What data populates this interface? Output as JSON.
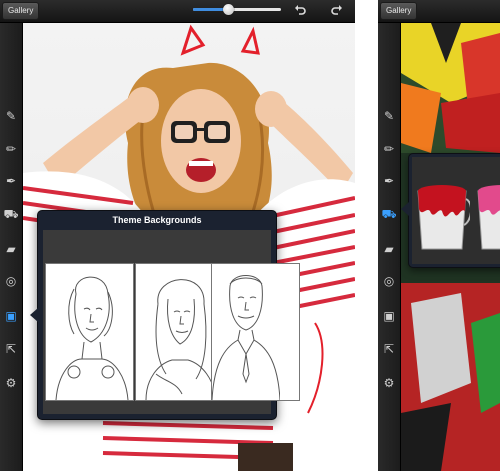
{
  "left_screen": {
    "topbar": {
      "gallery_label": "Gallery",
      "brush_size_level": 0.4,
      "undo_icon": "undo-icon",
      "redo_icon": "redo-icon"
    },
    "tools": [
      {
        "name": "marker-icon",
        "glyph": "✎"
      },
      {
        "name": "pencil-icon",
        "glyph": "✏"
      },
      {
        "name": "pen-icon",
        "glyph": "✒"
      },
      {
        "name": "paint-bucket-icon",
        "glyph": "⛟"
      },
      {
        "name": "eraser-icon",
        "glyph": "▰"
      },
      {
        "name": "spiral-icon",
        "glyph": "◎"
      },
      {
        "name": "image-icon",
        "glyph": "▣",
        "active": true
      },
      {
        "name": "share-icon",
        "glyph": "⇱"
      },
      {
        "name": "settings-icon",
        "glyph": "⚙"
      }
    ],
    "theme_popover": {
      "title": "Theme Backgrounds",
      "thumbnails": [
        "woman-sketch-thumbnail",
        "woman-portrait-sketch-thumbnail",
        "man-suit-sketch-thumbnail"
      ]
    }
  },
  "right_screen": {
    "topbar": {
      "gallery_label": "Gallery"
    },
    "tools": [
      {
        "name": "marker-icon",
        "glyph": "✎"
      },
      {
        "name": "pencil-icon",
        "glyph": "✏"
      },
      {
        "name": "pen-icon",
        "glyph": "✒"
      },
      {
        "name": "paint-bucket-icon",
        "glyph": "⛟",
        "active": true
      },
      {
        "name": "eraser-icon",
        "glyph": "▰"
      },
      {
        "name": "spiral-icon",
        "glyph": "◎"
      },
      {
        "name": "image-icon",
        "glyph": "▣"
      },
      {
        "name": "share-icon",
        "glyph": "⇱"
      },
      {
        "name": "settings-icon",
        "glyph": "⚙"
      }
    ],
    "bucket_popover": {
      "items": [
        "red-paint-bucket",
        "pink-paint-bucket"
      ]
    }
  },
  "colors": {
    "accent": "#3aa0ff",
    "toolbar": "#1f1f1f",
    "popover": "#1b2230",
    "scribble": "#e3202b"
  }
}
